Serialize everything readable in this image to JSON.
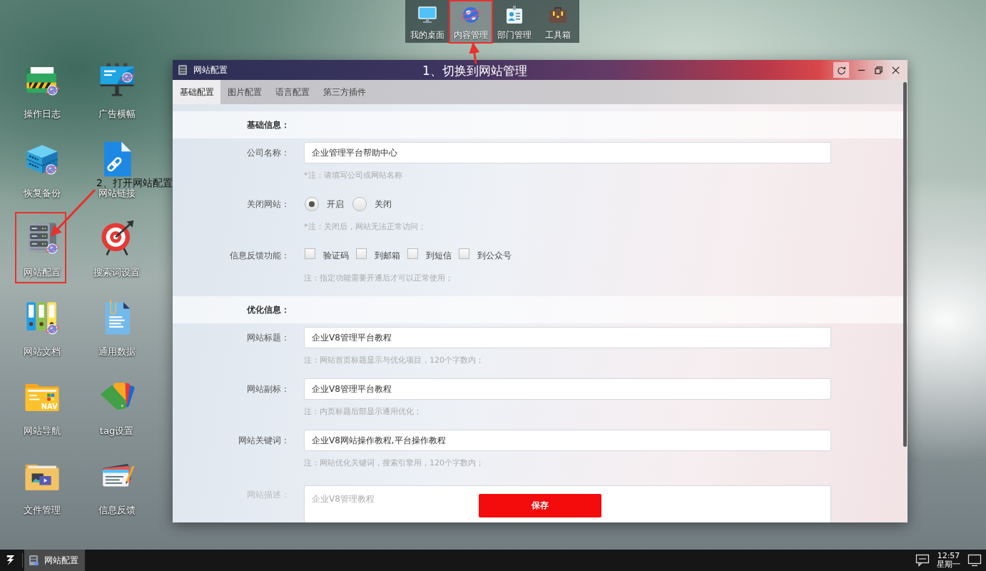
{
  "dock": {
    "items": [
      {
        "label": "我的桌面",
        "selected": false
      },
      {
        "label": "内容管理",
        "selected": true
      },
      {
        "label": "部门管理",
        "selected": false
      },
      {
        "label": "工具箱",
        "selected": false
      }
    ]
  },
  "desktop_icons": [
    {
      "label": "操作日志"
    },
    {
      "label": "广告横幅"
    },
    {
      "label": "恢复备份"
    },
    {
      "label": "网站链接"
    },
    {
      "label": "网站配置"
    },
    {
      "label": "搜索词设置"
    },
    {
      "label": "网站文档"
    },
    {
      "label": "通用数据"
    },
    {
      "label": "网站导航",
      "icon_text": "NAV"
    },
    {
      "label": "tag设置"
    },
    {
      "label": "文件管理"
    },
    {
      "label": "信息反馈"
    }
  ],
  "window": {
    "title": "网站配置",
    "tabs": [
      {
        "label": "基础配置",
        "selected": true
      },
      {
        "label": "图片配置",
        "selected": false
      },
      {
        "label": "语言配置",
        "selected": false
      },
      {
        "label": "第三方插件",
        "selected": false
      }
    ],
    "sections": [
      {
        "heading": "基础信息：",
        "rows": [
          {
            "kind": "text",
            "label": "公司名称：",
            "value": "企业管理平台帮助中心",
            "note": "*注：请填写公司或网站名称"
          },
          {
            "kind": "radio",
            "label": "关闭网站：",
            "options": [
              {
                "label": "开启",
                "selected": true
              },
              {
                "label": "关闭",
                "selected": false
              }
            ],
            "note": "*注：关闭后，网站无法正常访问；"
          },
          {
            "kind": "checkbox",
            "label": "信息反馈功能：",
            "options": [
              {
                "label": "验证码",
                "checked": false
              },
              {
                "label": "到邮箱",
                "checked": false
              },
              {
                "label": "到短信",
                "checked": false
              },
              {
                "label": "到公众号",
                "checked": false
              }
            ],
            "note": "注：指定功能需要开通后才可以正常使用；"
          }
        ]
      },
      {
        "heading": "优化信息：",
        "rows": [
          {
            "kind": "text",
            "label": "网站标题：",
            "value": "企业V8管理平台教程",
            "note": "注：网站首页标题显示与优化项目，120个字数内；"
          },
          {
            "kind": "text",
            "label": "网站副标：",
            "value": "企业V8管理平台教程",
            "note": "注：内页标题后部显示通用优化；"
          },
          {
            "kind": "text",
            "label": "网站关键词：",
            "value": "企业V8网站操作教程,平台操作教程",
            "note": "注：网站优化关键词，搜索引擎用，120个字数内；"
          },
          {
            "kind": "textarea",
            "label": "网站描述：",
            "value": "企业V8管理教程"
          }
        ]
      }
    ],
    "save_button": "保存"
  },
  "taskbar": {
    "tasks": [
      {
        "label": "网站配置",
        "selected": true
      }
    ],
    "clock": {
      "time": "12:57",
      "day": "星期一"
    }
  },
  "annotations": [
    {
      "text": "1、切换到网站管理"
    },
    {
      "text": "2、打开网站配置"
    }
  ]
}
